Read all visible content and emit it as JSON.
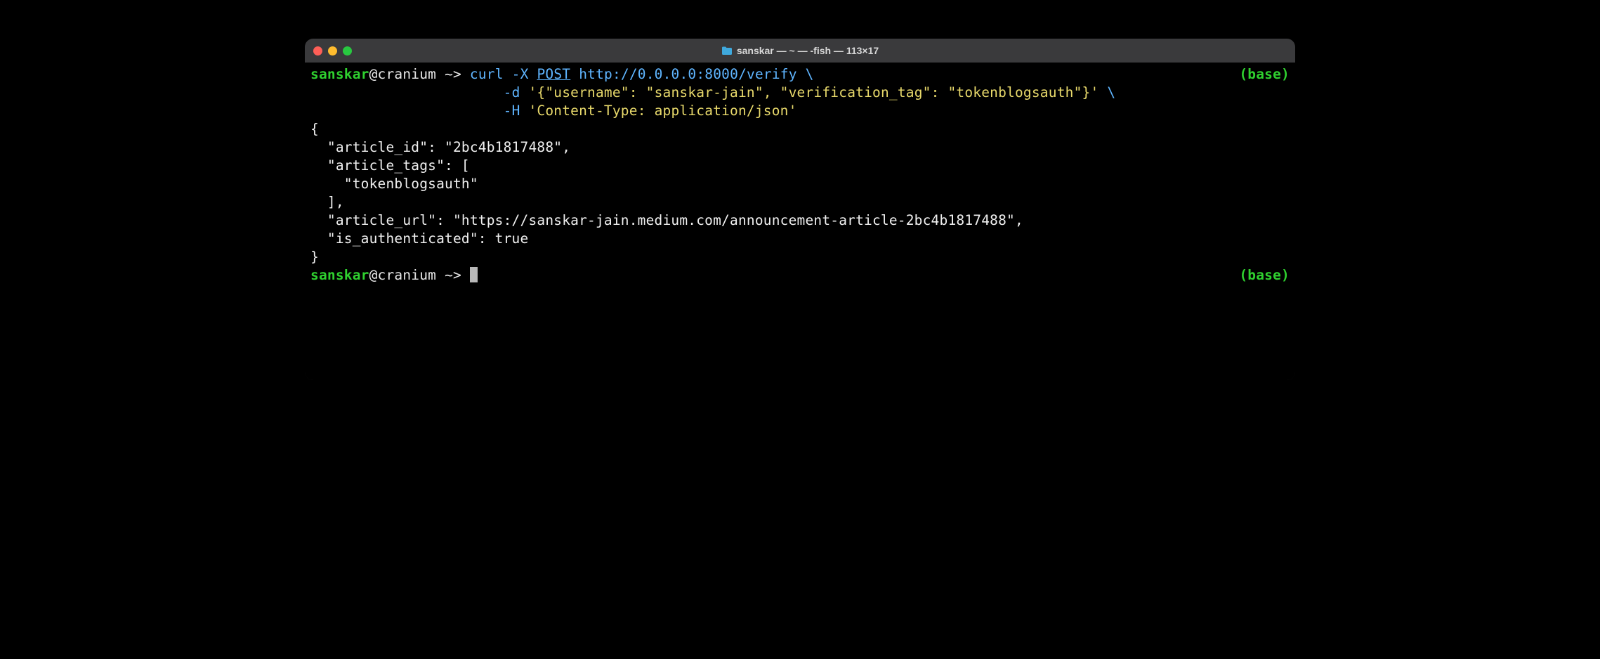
{
  "window": {
    "title": "sanskar — ~ — -fish — 113×17"
  },
  "prompt": {
    "user": "sanskar",
    "at": "@",
    "host": "cranium",
    "path": " ~>",
    "env": "(base)"
  },
  "command": {
    "cmd": "curl",
    "flag_x": "-X",
    "method": "POST",
    "url": "http://0.0.0.0:8000/verify",
    "cont": "\\",
    "indent1": "                       ",
    "flag_d": "-d",
    "data": "'{\"username\": \"sanskar-jain\", \"verification_tag\": \"tokenblogsauth\"}'",
    "flag_h": "-H",
    "header": "'Content-Type: application/json'"
  },
  "output": {
    "l1": "{",
    "l2": "  \"article_id\": \"2bc4b1817488\",",
    "l3": "  \"article_tags\": [",
    "l4": "    \"tokenblogsauth\"",
    "l5": "  ],",
    "l6": "  \"article_url\": \"https://sanskar-jain.medium.com/announcement-article-2bc4b1817488\",",
    "l7": "  \"is_authenticated\": true",
    "l8": "}"
  }
}
